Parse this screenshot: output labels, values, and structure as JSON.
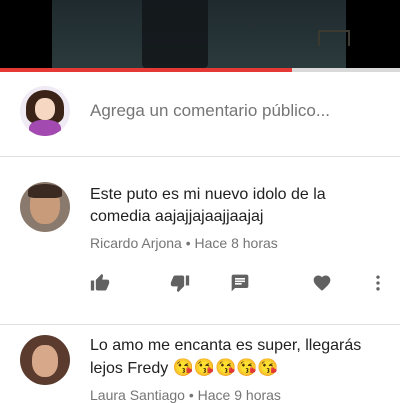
{
  "video": {
    "progress_fraction": 0.73,
    "progress_color": "#e53935"
  },
  "composer": {
    "placeholder": "Agrega un comentario público..."
  },
  "comments": [
    {
      "text": "Este puto es mi nuevo idolo de la comedia aajajjajaajjaajaj",
      "author": "Ricardo Arjona",
      "separator": "•",
      "time": "Hace 8 horas",
      "actions": [
        "thumb-up-icon",
        "thumb-down-icon",
        "reply-icon",
        "heart-icon",
        "more-vert-icon"
      ]
    },
    {
      "text": "Lo amo me encanta es super, llegarás lejos Fredy",
      "emojis": [
        "😘",
        "😘",
        "😘",
        "😘",
        "😘"
      ],
      "author": "Laura Santiago",
      "separator": "•",
      "time": "Hace 9 horas"
    }
  ],
  "colors": {
    "icon": "#616161",
    "secondary_text": "#757575",
    "divider": "#e0e0e0"
  }
}
